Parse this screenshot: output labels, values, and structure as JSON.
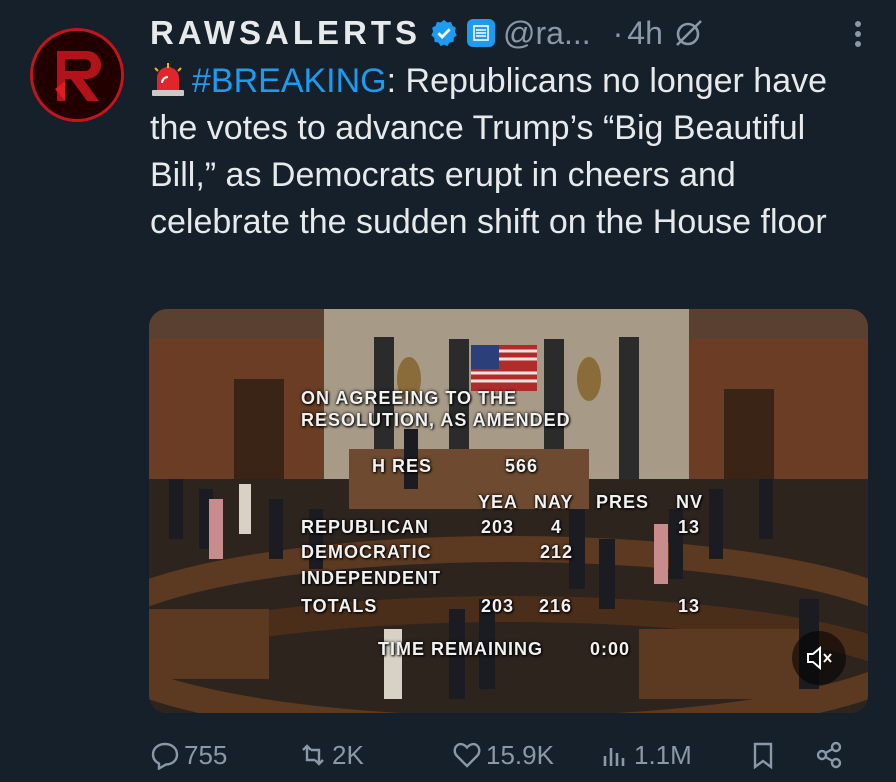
{
  "account": {
    "display_name": "RAWSALERTS",
    "handle": "@ra...",
    "time": "4h",
    "dot": "·"
  },
  "tweet": {
    "hashtag": "#BREAKING",
    "text": ": Republicans no longer have the votes to advance Trump’s “Big Beautiful Bill,” as Democrats erupt in cheers and celebrate the sudden shift on the House floor"
  },
  "media": {
    "vote_board": {
      "line1": "ON AGREEING TO THE",
      "line2": "RESOLUTION, AS AMENDED",
      "bill_label": "H RES",
      "bill_number": "566",
      "col_yea": "YEA",
      "col_nay": "NAY",
      "col_pres": "PRES",
      "col_nv": "NV",
      "row_rep": "REPUBLICAN",
      "rep_yea": "203",
      "rep_nay": "4",
      "rep_nv": "13",
      "row_dem": "DEMOCRATIC",
      "dem_nay": "212",
      "row_ind": "INDEPENDENT",
      "row_tot": "TOTALS",
      "tot_yea": "203",
      "tot_nay": "216",
      "tot_nv": "13",
      "time_label": "TIME REMAINING",
      "time_value": "0:00"
    }
  },
  "actions": {
    "replies": "755",
    "reposts": "2K",
    "likes": "15.9K",
    "views": "1.1M"
  },
  "icons": [
    "verified-badge-icon",
    "affiliate-badge-icon",
    "grok-icon",
    "more-icon",
    "siren-icon",
    "mute-icon",
    "reply-icon",
    "repost-icon",
    "like-icon",
    "views-icon",
    "bookmark-icon",
    "share-icon"
  ],
  "colors": {
    "background": "#15202b",
    "accent": "#1d9bf0",
    "muted": "#8b98a5",
    "avatar_ring": "#c3151c"
  }
}
